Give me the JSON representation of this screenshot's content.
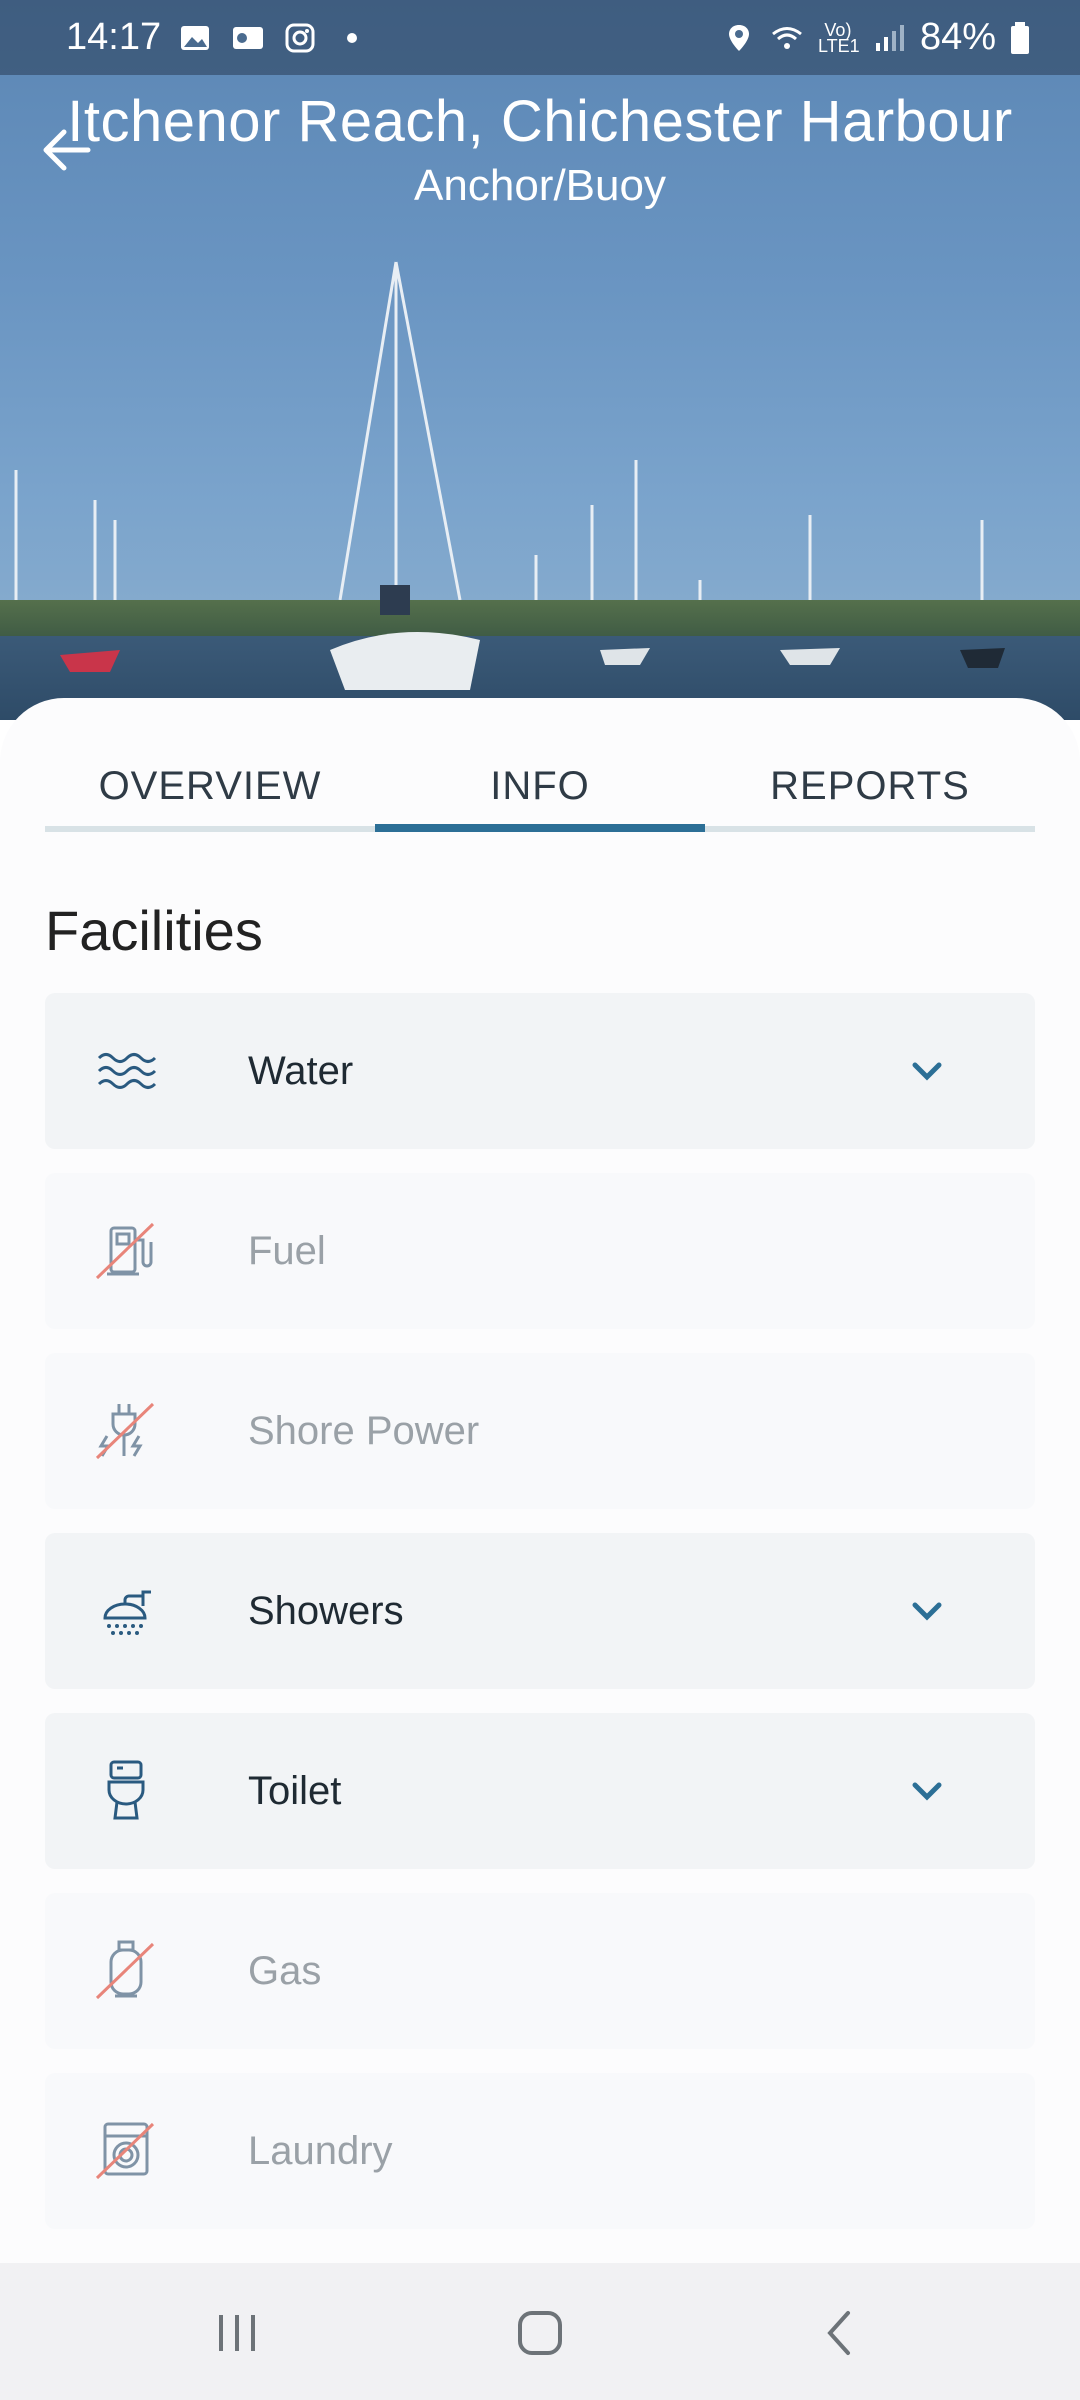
{
  "status_bar": {
    "time": "14:17",
    "battery": "84%",
    "network": "Vo) LTE1",
    "icons": [
      "image-icon",
      "outlook-icon",
      "instagram-icon",
      "dot-icon",
      "location-icon",
      "wifi-icon",
      "signal-icon",
      "battery-icon"
    ]
  },
  "header": {
    "title": "Itchenor Reach, Chichester Harbour",
    "subtitle": "Anchor/Buoy"
  },
  "tabs": [
    {
      "label": "OVERVIEW",
      "active": false
    },
    {
      "label": "INFO",
      "active": true
    },
    {
      "label": "REPORTS",
      "active": false
    }
  ],
  "section": {
    "title": "Facilities"
  },
  "facilities": [
    {
      "label": "Water",
      "icon": "water-icon",
      "available": true
    },
    {
      "label": "Fuel",
      "icon": "fuel-pump-icon",
      "available": false
    },
    {
      "label": "Shore Power",
      "icon": "shore-power-icon",
      "available": false
    },
    {
      "label": "Showers",
      "icon": "shower-icon",
      "available": true
    },
    {
      "label": "Toilet",
      "icon": "toilet-icon",
      "available": true
    },
    {
      "label": "Gas",
      "icon": "gas-bottle-icon",
      "available": false
    },
    {
      "label": "Laundry",
      "icon": "washing-machine-icon",
      "available": false
    }
  ],
  "colors": {
    "accent": "#2c6f96",
    "icon_blue": "#2a5a80",
    "strike_red": "#e8857a"
  }
}
